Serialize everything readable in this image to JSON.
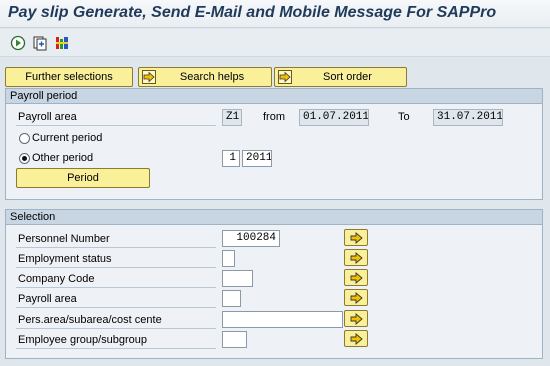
{
  "window": {
    "title": "Pay slip Generate, Send E-Mail and Mobile Message For SAPPro"
  },
  "toolbar": {
    "icons": [
      "execute-icon",
      "get-variant-icon",
      "selection-options-icon"
    ]
  },
  "selection_buttons": {
    "further_selections": "Further selections",
    "search_helps": "Search helps",
    "sort_order": "Sort order"
  },
  "payroll_period": {
    "header": "Payroll period",
    "payroll_area_label": "Payroll area",
    "payroll_area_value": "Z1",
    "from_label": "from",
    "from_value": "01.07.2011",
    "to_label": "To",
    "to_value": "31.07.2011",
    "current_period_label": "Current period",
    "other_period_label": "Other period",
    "other_period_selected": true,
    "period_number": "1",
    "period_year": "2011",
    "period_button": "Period"
  },
  "selection": {
    "header": "Selection",
    "rows": [
      {
        "label": "Personnel Number",
        "value": "100284"
      },
      {
        "label": "Employment status",
        "value": ""
      },
      {
        "label": "Company Code",
        "value": ""
      },
      {
        "label": "Payroll area",
        "value": ""
      },
      {
        "label": "Pers.area/subarea/cost cente",
        "value": ""
      },
      {
        "label": "Employee group/subgroup",
        "value": ""
      }
    ]
  },
  "colors": {
    "background": "#dfe6ec",
    "button_yellow": "#fbf09a",
    "title_text": "#1f3a5a"
  }
}
